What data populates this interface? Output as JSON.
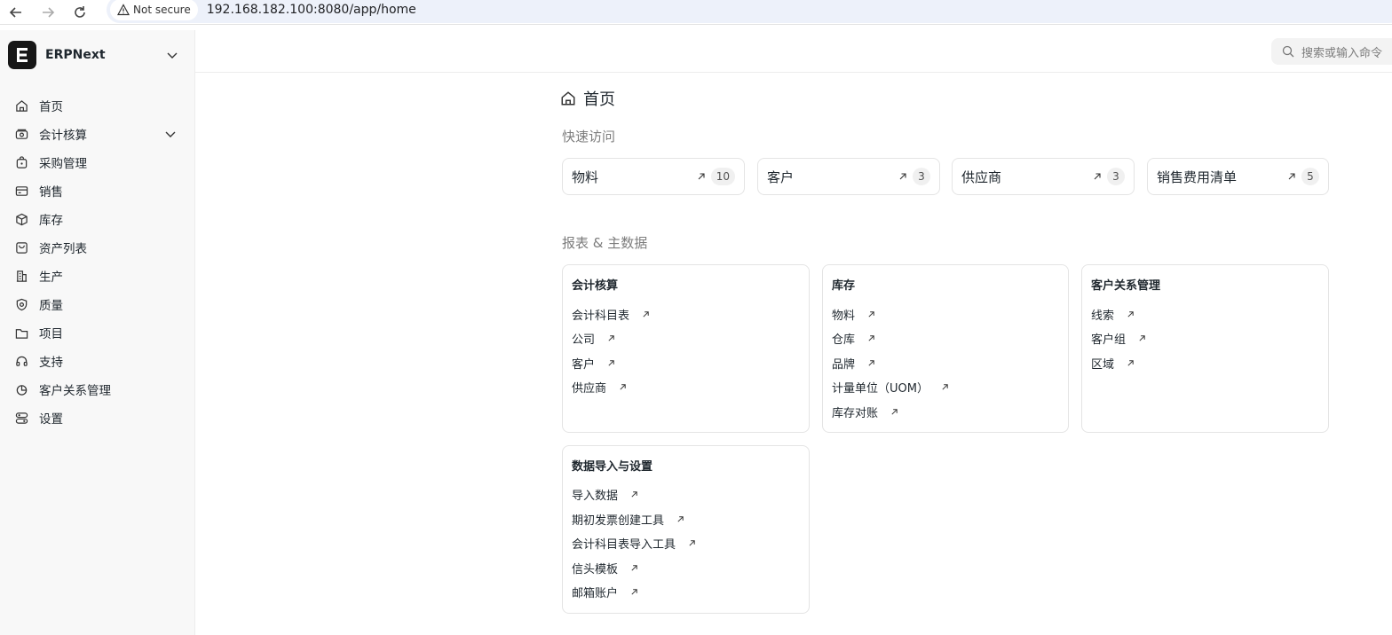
{
  "browser": {
    "security_label": "Not secure",
    "url": "192.168.182.100:8080/app/home"
  },
  "sidebar": {
    "app_name": "ERPNext",
    "items": [
      {
        "label": "首页",
        "icon": "home-icon"
      },
      {
        "label": "会计核算",
        "icon": "accounting-icon"
      },
      {
        "label": "采购管理",
        "icon": "buying-icon"
      },
      {
        "label": "销售",
        "icon": "selling-icon"
      },
      {
        "label": "库存",
        "icon": "stock-icon"
      },
      {
        "label": "资产列表",
        "icon": "assets-icon"
      },
      {
        "label": "生产",
        "icon": "manufacturing-icon"
      },
      {
        "label": "质量",
        "icon": "quality-icon"
      },
      {
        "label": "项目",
        "icon": "projects-icon"
      },
      {
        "label": "支持",
        "icon": "support-icon"
      },
      {
        "label": "客户关系管理",
        "icon": "crm-icon"
      },
      {
        "label": "设置",
        "icon": "settings-icon"
      }
    ]
  },
  "topbar": {
    "search_placeholder": "搜索或输入命令"
  },
  "main": {
    "page_title": "首页",
    "quick_access_title": "快速访问",
    "shortcuts": [
      {
        "label": "物料",
        "count": "10"
      },
      {
        "label": "客户",
        "count": "3"
      },
      {
        "label": "供应商",
        "count": "3"
      },
      {
        "label": "销售费用清单",
        "count": "5"
      }
    ],
    "reports_title": "报表 & 主数据",
    "cards": [
      {
        "title": "会计核算",
        "links": [
          "会计科目表",
          "公司",
          "客户",
          "供应商"
        ]
      },
      {
        "title": "库存",
        "links": [
          "物料",
          "仓库",
          "品牌",
          "计量单位（UOM）",
          "库存对账"
        ]
      },
      {
        "title": "客户关系管理",
        "links": [
          "线索",
          "客户组",
          "区域"
        ]
      },
      {
        "title": "数据导入与设置",
        "links": [
          "导入数据",
          "期初发票创建工具",
          "会计科目表导入工具",
          "信头模板",
          "邮箱账户"
        ]
      }
    ]
  }
}
